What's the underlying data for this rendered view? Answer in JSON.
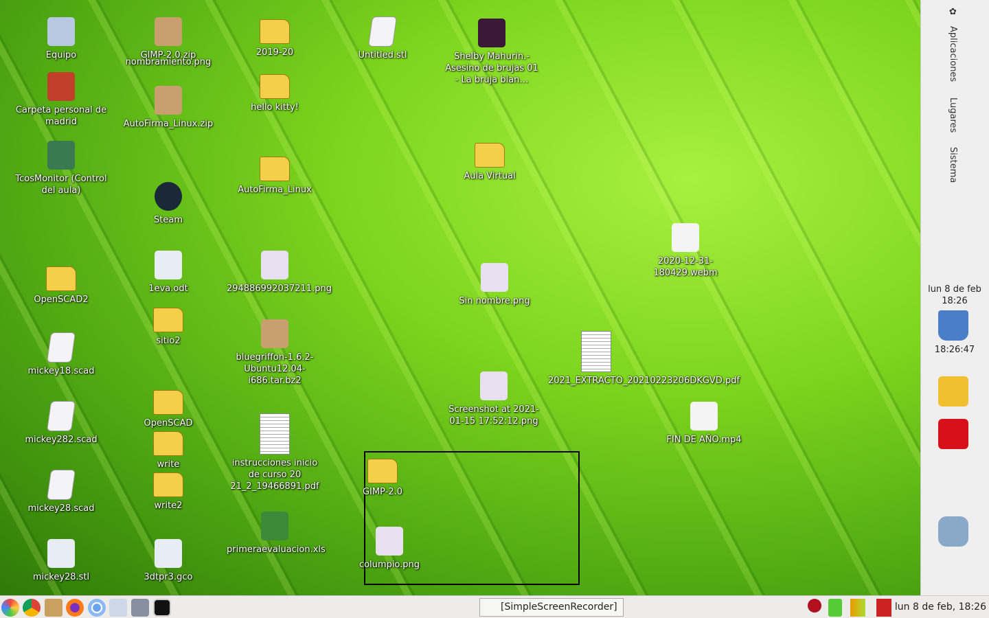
{
  "desktop_icons": [
    {
      "label": "Equipo",
      "type": "computer"
    },
    {
      "label": "Carpeta personal de madrid",
      "type": "home"
    },
    {
      "label": "TcosMonitor (Control del aula)",
      "type": "app"
    },
    {
      "label": "OpenSCAD2",
      "type": "folder"
    },
    {
      "label": "mickey18.scad",
      "type": "doc"
    },
    {
      "label": "mickey282.scad",
      "type": "doc"
    },
    {
      "label": "mickey28.scad",
      "type": "doc"
    },
    {
      "label": "mickey28.stl",
      "type": "text"
    },
    {
      "label": "GIMP-2.0.zip",
      "type": "archive"
    },
    {
      "label": "nombramiento.png",
      "type": "image"
    },
    {
      "label": "AutoFirma_Linux.zip",
      "type": "archive"
    },
    {
      "label": "Steam",
      "type": "steam"
    },
    {
      "label": "1eva.odt",
      "type": "text"
    },
    {
      "label": "sitio2",
      "type": "folder"
    },
    {
      "label": "OpenSCAD",
      "type": "folder"
    },
    {
      "label": "write",
      "type": "folder"
    },
    {
      "label": "write2",
      "type": "folder"
    },
    {
      "label": "3dtpr3.gco",
      "type": "text"
    },
    {
      "label": "2019-20",
      "type": "folder"
    },
    {
      "label": "hello kitty!",
      "type": "folder"
    },
    {
      "label": "AutoFirma_Linux",
      "type": "folder"
    },
    {
      "label": "294886992037211.png",
      "type": "image"
    },
    {
      "label": "bluegriffon-1.6.2-Ubuntu12.04-i686.tar.bz2",
      "type": "archive"
    },
    {
      "label": "instrucciones inicio de curso 20 21_2_19466891.pdf",
      "type": "pdf"
    },
    {
      "label": "primeraevaluacion.xls",
      "type": "sheet"
    },
    {
      "label": "Untitled.stl",
      "type": "doc"
    },
    {
      "label": "Shelby Mahurin.- Asesino de brujas 01 - La bruja blan…",
      "type": "book"
    },
    {
      "label": "Aula Virtual",
      "type": "folder"
    },
    {
      "label": "Sin nombre.png",
      "type": "image"
    },
    {
      "label": "Screenshot at 2021-01-15 17:52:12.png",
      "type": "image"
    },
    {
      "label": "2021_EXTRACTO_20210223206DKGVD.pdf",
      "type": "pdf"
    },
    {
      "label": "GIMP-2.0",
      "type": "folder"
    },
    {
      "label": "columpio.png",
      "type": "image"
    },
    {
      "label": "2020-12-31-180429.webm",
      "type": "video"
    },
    {
      "label": "FIN DE AÑO.mp4",
      "type": "video"
    }
  ],
  "side_panel": {
    "menus": [
      "Aplicaciones",
      "Lugares",
      "Sistema"
    ],
    "date": "lun  8 de feb",
    "time": "18:26",
    "seconds_clock": "18:26:47"
  },
  "taskbar": {
    "launchers": [
      "menu-icon",
      "chrome-icon",
      "editor-icon",
      "firefox-icon",
      "chromium-icon",
      "notes-icon",
      "screenshot-icon",
      "terminal-icon"
    ],
    "task": "[SimpleScreenRecorder]",
    "clock": "lun  8 de feb, 18:26"
  }
}
